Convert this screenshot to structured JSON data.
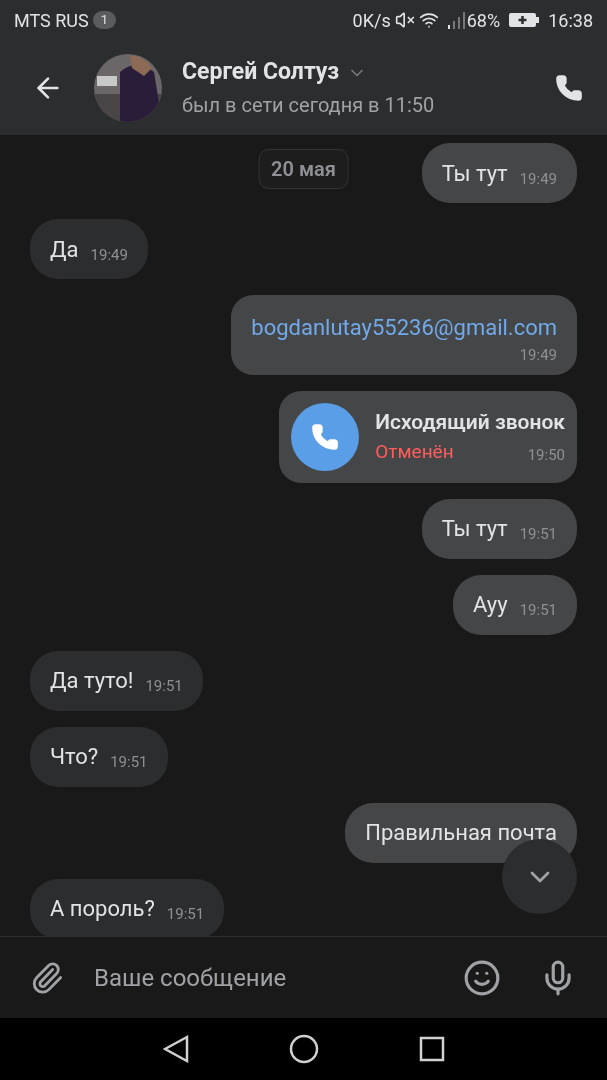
{
  "status_bar": {
    "carrier": "MTS RUS",
    "sim_badge": "1",
    "speed": "0K/s",
    "battery": "68%",
    "time": "16:38"
  },
  "header": {
    "name": "Сергей Солтуз",
    "status": "был в сети сегодня в 11:50"
  },
  "date_chip": "20 мая",
  "messages": [
    {
      "kind": "text",
      "outgoing": true,
      "text": "Ты тут",
      "time": "19:49"
    },
    {
      "kind": "text",
      "outgoing": false,
      "text": "Да",
      "time": "19:49"
    },
    {
      "kind": "link",
      "outgoing": true,
      "text": "bogdanlutay55236@gmail.com",
      "time": "19:49"
    },
    {
      "kind": "call",
      "outgoing": true,
      "text": "Исходящий звонок",
      "status": "Отменён",
      "time": "19:50"
    },
    {
      "kind": "text",
      "outgoing": true,
      "text": "Ты тут",
      "time": "19:51"
    },
    {
      "kind": "text",
      "outgoing": true,
      "text": "Ауу",
      "time": "19:51"
    },
    {
      "kind": "text",
      "outgoing": false,
      "text": "Да туто!",
      "time": "19:51"
    },
    {
      "kind": "text",
      "outgoing": false,
      "text": "Что?",
      "time": "19:51"
    },
    {
      "kind": "text",
      "outgoing": true,
      "text": "Правильная почта"
    },
    {
      "kind": "text",
      "outgoing": false,
      "text": "А пороль?",
      "time": "19:51"
    }
  ],
  "composer": {
    "placeholder": "Ваше сообщение"
  }
}
